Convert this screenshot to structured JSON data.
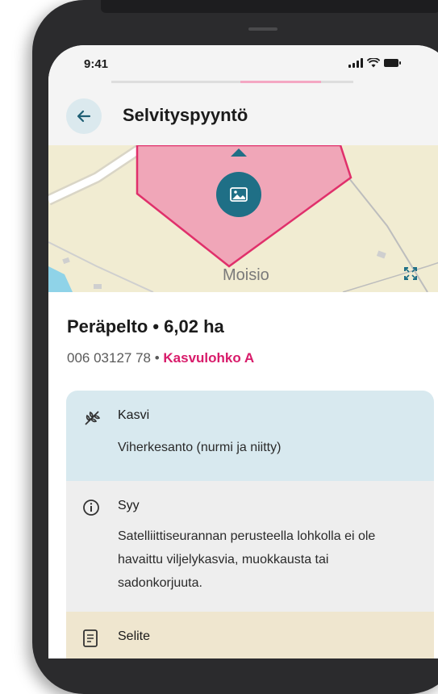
{
  "status_bar": {
    "time": "9:41"
  },
  "header": {
    "title": "Selvityspyyntö"
  },
  "map": {
    "place_label": "Moisio"
  },
  "field": {
    "name": "Peräpelto • 6,02 ha",
    "id": "006 03127 78",
    "separator": " • ",
    "parcel_link": "Kasvulohko A"
  },
  "cards": {
    "kasvi": {
      "label": "Kasvi",
      "text": "Viherkesanto (nurmi ja niitty)"
    },
    "syy": {
      "label": "Syy",
      "text": "Satelliittiseurannan perusteella lohkolla ei ole havaittu viljelykasvia, muokkausta tai sadonkorjuuta."
    },
    "selite": {
      "label": "Selite"
    }
  },
  "colors": {
    "accent": "#1f6f86",
    "link": "#d81b6a",
    "parcel_fill": "#f0a6b8",
    "parcel_stroke": "#e0306b",
    "card_kasvi_bg": "#d8e9ef",
    "card_syy_bg": "#eeeeee",
    "card_selite_bg": "#efe6cf"
  }
}
